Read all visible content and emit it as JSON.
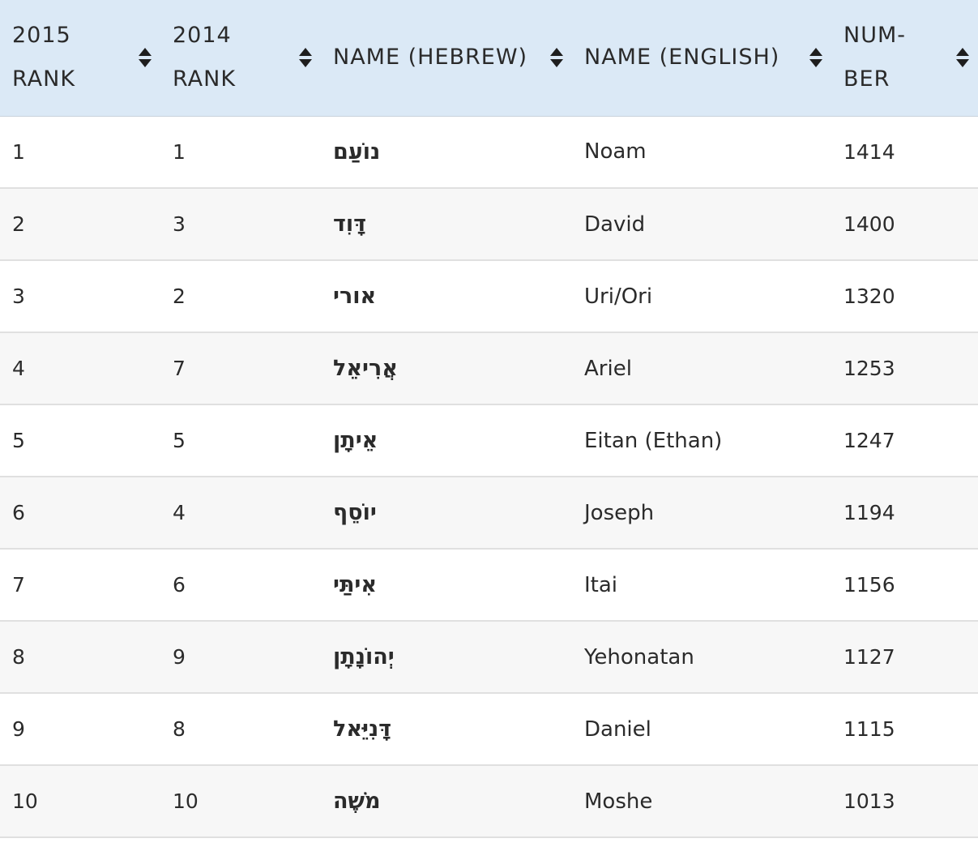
{
  "table": {
    "headers": [
      {
        "line1": "2015",
        "line2": "RANK"
      },
      {
        "line1": "2014",
        "line2": "RANK"
      },
      {
        "line1": "NAME (HEBREW)",
        "line2": ""
      },
      {
        "line1": "NAME (ENGLISH)",
        "line2": ""
      },
      {
        "line1": "NUM-",
        "line2": "BER"
      }
    ],
    "sort_icon": "sort-up-down-icon",
    "colors": {
      "header_bg": "#dbe9f6",
      "row_alt_bg": "#f7f7f7",
      "divider": "#e0e0e0"
    },
    "rows": [
      {
        "rank2015": "1",
        "rank2014": "1",
        "hebrew": "נוֹעַם",
        "english": "Noam",
        "number": "1414"
      },
      {
        "rank2015": "2",
        "rank2014": "3",
        "hebrew": "דָּוִד",
        "english": "David",
        "number": "1400"
      },
      {
        "rank2015": "3",
        "rank2014": "2",
        "hebrew": "אורי",
        "english": "Uri/Ori",
        "number": "1320"
      },
      {
        "rank2015": "4",
        "rank2014": "7",
        "hebrew": "אֲרִיאֵל",
        "english": "Ariel",
        "number": "1253"
      },
      {
        "rank2015": "5",
        "rank2014": "5",
        "hebrew": "אֵיתָן",
        "english": "Eitan (Ethan)",
        "number": "1247"
      },
      {
        "rank2015": "6",
        "rank2014": "4",
        "hebrew": "יוֹסֵף",
        "english": "Joseph",
        "number": "1194"
      },
      {
        "rank2015": "7",
        "rank2014": "6",
        "hebrew": "אִיתַּי",
        "english": "Itai",
        "number": "1156"
      },
      {
        "rank2015": "8",
        "rank2014": "9",
        "hebrew": "יְהוֹנָתָן",
        "english": "Yehonatan",
        "number": "1127"
      },
      {
        "rank2015": "9",
        "rank2014": "8",
        "hebrew": "דָּנִיֵּאל",
        "english": "Daniel",
        "number": "1115"
      },
      {
        "rank2015": "10",
        "rank2014": "10",
        "hebrew": "מֹשֶׁה",
        "english": "Moshe",
        "number": "1013"
      }
    ]
  }
}
